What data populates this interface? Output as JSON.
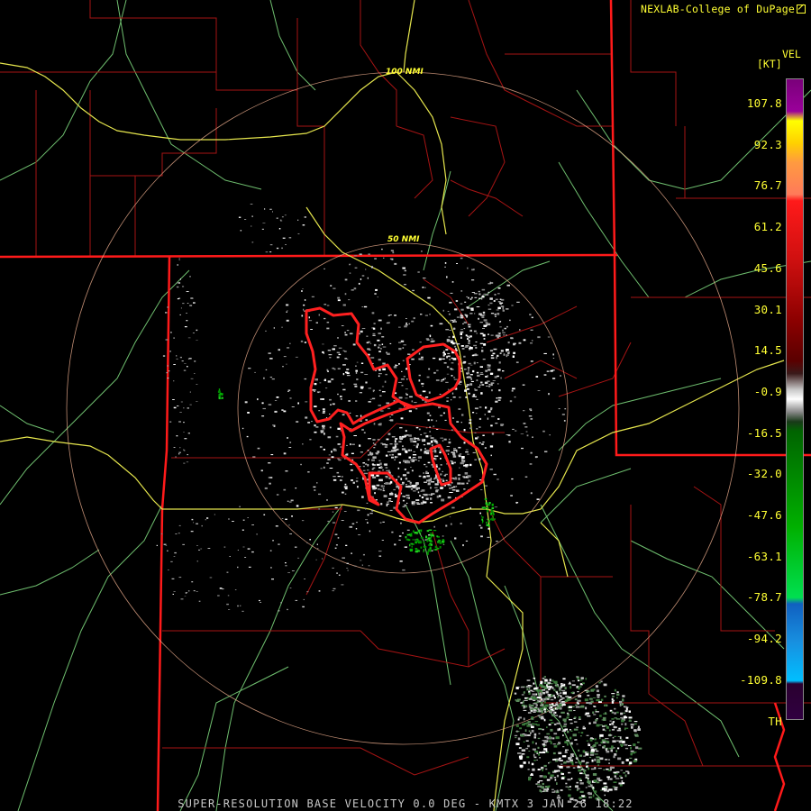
{
  "credit": "NEXLAB-College of DuPage",
  "logo_icon": "nexlab-logo-icon",
  "legend": {
    "title": "VEL",
    "unit": "[KT]",
    "ticks": [
      "107.8",
      "92.3",
      "76.7",
      "61.2",
      "45.6",
      "30.1",
      "14.5",
      "-0.9",
      "-16.5",
      "-32.0",
      "-47.6",
      "-63.1",
      "-78.7",
      "-94.2",
      "-109.8",
      "TH"
    ]
  },
  "rings": {
    "inner_label": "50 NMI",
    "outer_label": "100 NMI"
  },
  "footer": "SUPER-RESOLUTION BASE VELOCITY 0.0 DEG - KMTX 3 JAN 26 18:22",
  "colors": {
    "state_border": "#ff1a1a",
    "county_border": "#b01010",
    "highway": "#e6e64d",
    "road": "#7ad07a",
    "warning_polygon": "#ff2020",
    "range_ring": "#f0b090",
    "text": "#ffff33"
  }
}
